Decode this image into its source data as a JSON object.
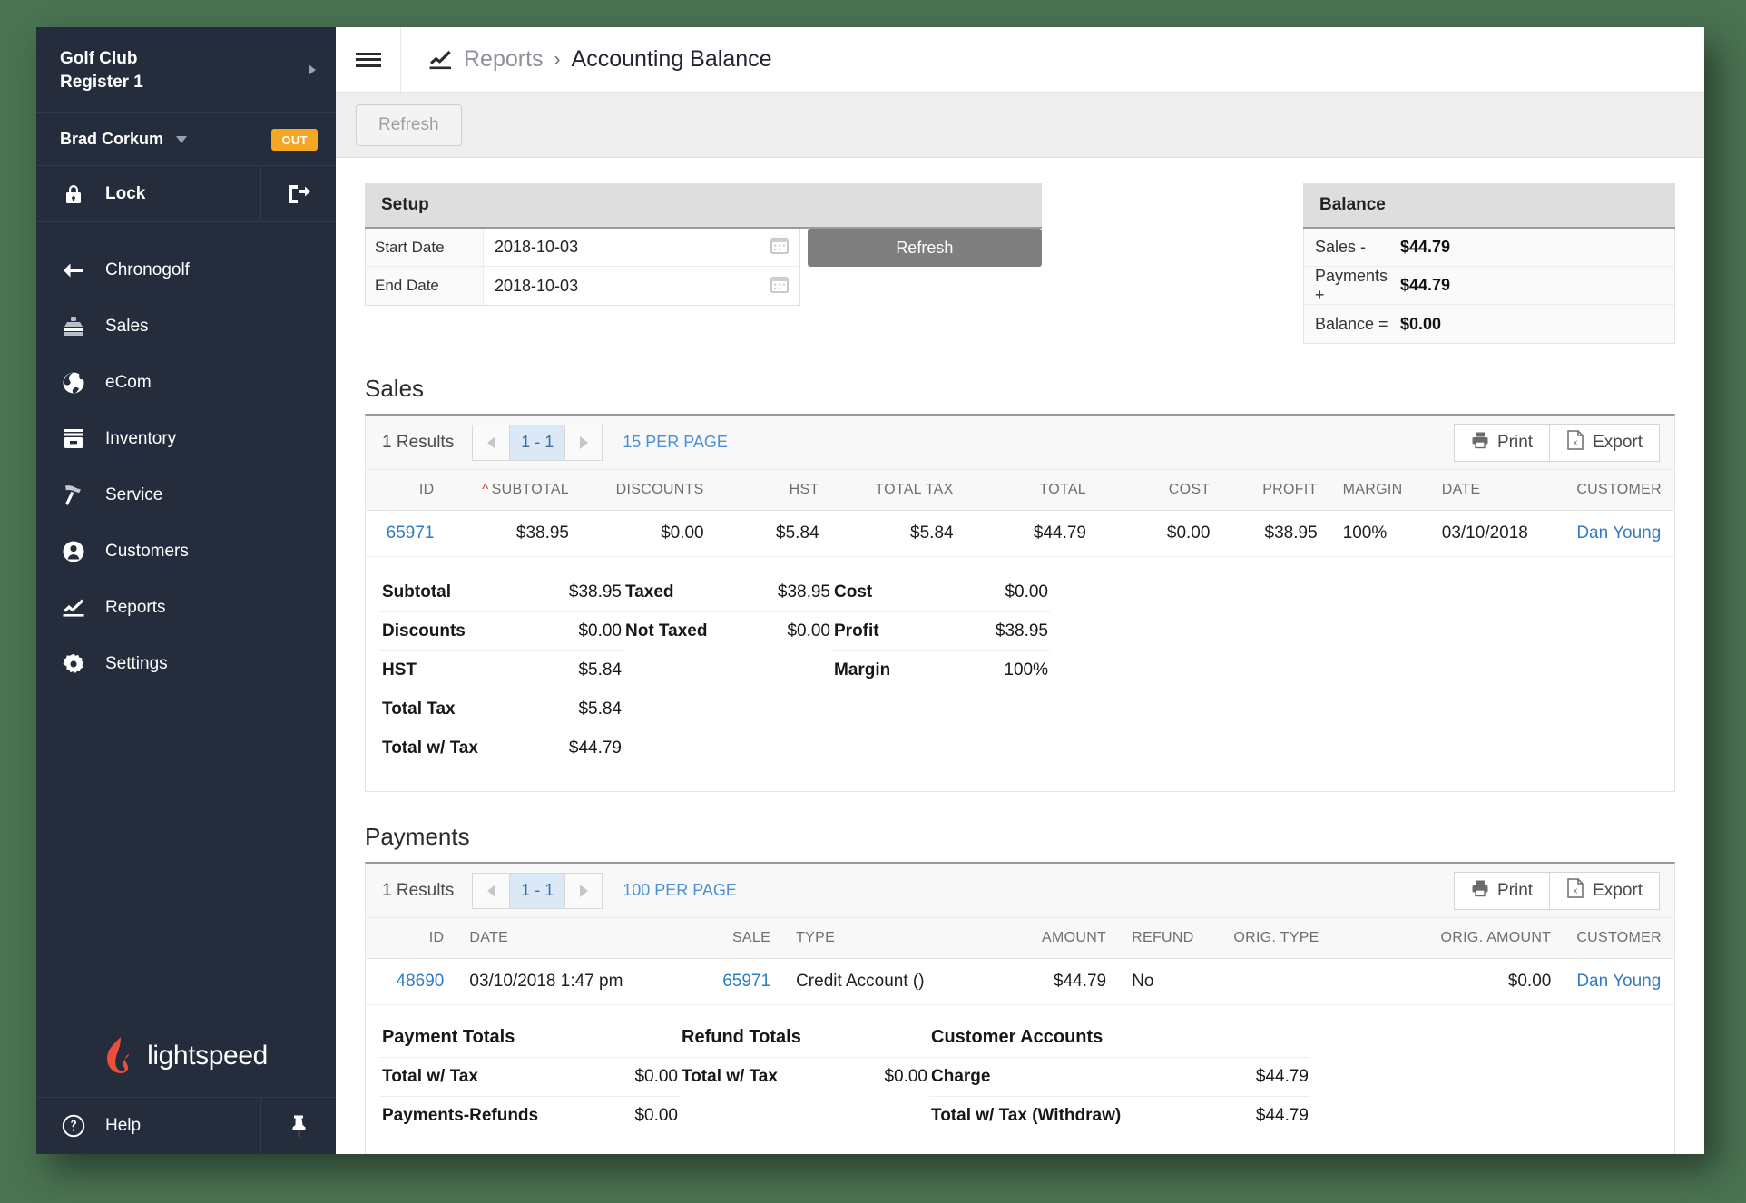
{
  "sidebar": {
    "store_line1": "Golf Club",
    "store_line2": "Register 1",
    "user_name": "Brad Corkum",
    "status_badge": "OUT",
    "lock_label": "Lock",
    "nav": [
      {
        "label": "Chronogolf",
        "icon": "arrow-left-icon"
      },
      {
        "label": "Sales",
        "icon": "register-icon"
      },
      {
        "label": "eCom",
        "icon": "globe-icon"
      },
      {
        "label": "Inventory",
        "icon": "box-icon"
      },
      {
        "label": "Service",
        "icon": "hammer-icon"
      },
      {
        "label": "Customers",
        "icon": "person-icon"
      },
      {
        "label": "Reports",
        "icon": "chart-icon"
      },
      {
        "label": "Settings",
        "icon": "gear-icon"
      }
    ],
    "brand": "lightspeed",
    "help_label": "Help"
  },
  "header": {
    "breadcrumb_parent": "Reports",
    "breadcrumb_sep": "›",
    "breadcrumb_current": "Accounting Balance"
  },
  "toolbar": {
    "refresh_label": "Refresh"
  },
  "setup": {
    "title": "Setup",
    "start_date_label": "Start Date",
    "start_date_value": "2018-10-03",
    "end_date_label": "End Date",
    "end_date_value": "2018-10-03",
    "refresh_button": "Refresh"
  },
  "balance": {
    "title": "Balance",
    "rows": [
      {
        "label": "Sales -",
        "value": "$44.79"
      },
      {
        "label": "Payments +",
        "value": "$44.79"
      },
      {
        "label": "Balance =",
        "value": "$0.00"
      }
    ]
  },
  "sales": {
    "section_title": "Sales",
    "results": "1 Results",
    "page_range": "1 - 1",
    "per_page": "15 PER PAGE",
    "print_label": "Print",
    "export_label": "Export",
    "columns": [
      "ID",
      "SUBTOTAL",
      "DISCOUNTS",
      "HST",
      "TOTAL TAX",
      "TOTAL",
      "COST",
      "PROFIT",
      "MARGIN",
      "DATE",
      "CUSTOMER"
    ],
    "sorted_column": "SUBTOTAL",
    "rows": [
      {
        "id": "65971",
        "subtotal": "$38.95",
        "discounts": "$0.00",
        "hst": "$5.84",
        "total_tax": "$5.84",
        "total": "$44.79",
        "cost": "$0.00",
        "profit": "$38.95",
        "margin": "100%",
        "date": "03/10/2018",
        "customer": "Dan Young"
      }
    ],
    "totals_col1": [
      {
        "k": "Subtotal",
        "v": "$38.95"
      },
      {
        "k": "Discounts",
        "v": "$0.00"
      },
      {
        "k": "HST",
        "v": "$5.84"
      },
      {
        "k": "Total Tax",
        "v": "$5.84"
      },
      {
        "k": "Total w/ Tax",
        "v": "$44.79"
      }
    ],
    "totals_col2": [
      {
        "k": "Taxed",
        "v": "$38.95"
      },
      {
        "k": "Not Taxed",
        "v": "$0.00"
      }
    ],
    "totals_col3": [
      {
        "k": "Cost",
        "v": "$0.00"
      },
      {
        "k": "Profit",
        "v": "$38.95"
      },
      {
        "k": "Margin",
        "v": "100%"
      }
    ]
  },
  "payments": {
    "section_title": "Payments",
    "results": "1 Results",
    "page_range": "1 - 1",
    "per_page": "100 PER PAGE",
    "print_label": "Print",
    "export_label": "Export",
    "columns": [
      "ID",
      "DATE",
      "SALE",
      "TYPE",
      "AMOUNT",
      "REFUND",
      "ORIG. TYPE",
      "ORIG. AMOUNT",
      "CUSTOMER"
    ],
    "rows": [
      {
        "id": "48690",
        "date": "03/10/2018 1:47 pm",
        "sale": "65971",
        "type": "Credit Account ()",
        "amount": "$44.79",
        "refund": "No",
        "orig_type": "",
        "orig_amount": "$0.00",
        "customer": "Dan Young"
      }
    ],
    "payment_totals_head": "Payment Totals",
    "payment_totals": [
      {
        "k": "Total w/ Tax",
        "v": "$0.00"
      },
      {
        "k": "Payments-Refunds",
        "v": "$0.00"
      }
    ],
    "refund_totals_head": "Refund Totals",
    "refund_totals": [
      {
        "k": "Total w/ Tax",
        "v": "$0.00"
      }
    ],
    "customer_accounts_head": "Customer Accounts",
    "customer_accounts": [
      {
        "k": "Charge",
        "v": "$44.79"
      },
      {
        "k": "Total w/ Tax (Withdraw)",
        "v": "$44.79"
      }
    ]
  },
  "colors": {
    "sidebar_bg": "#252c3c",
    "accent_link": "#2f7cc4",
    "badge_orange": "#f5a623",
    "brand_red": "#e8503a",
    "desktop_green": "#4a7352"
  }
}
